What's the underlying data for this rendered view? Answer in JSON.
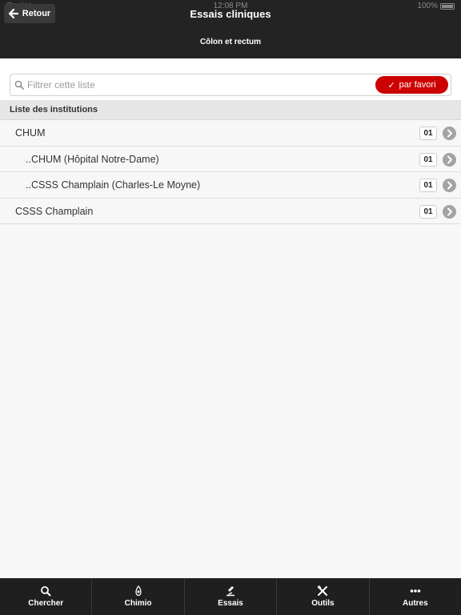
{
  "status_bar": {
    "carrier": "Carrier",
    "time": "12:08 PM",
    "battery": "100%"
  },
  "header": {
    "back_label": "Retour",
    "title": "Essais cliniques",
    "subtitle": "Côlon et rectum"
  },
  "filter": {
    "placeholder": "Filtrer cette liste",
    "value": "",
    "favorite_button": {
      "check": "✓",
      "label": "par favori"
    }
  },
  "section": {
    "title": "Liste des institutions"
  },
  "institutions": [
    {
      "label": "CHUM",
      "count": "01",
      "level": 0
    },
    {
      "label": "..CHUM (Hôpital Notre-Dame)",
      "count": "01",
      "level": 1
    },
    {
      "label": "..CSSS Champlain (Charles-Le Moyne)",
      "count": "01",
      "level": 1
    },
    {
      "label": "CSSS Champlain",
      "count": "01",
      "level": 0
    }
  ],
  "tabs": [
    {
      "label": "Chercher",
      "icon": "search-icon"
    },
    {
      "label": "Chimio",
      "icon": "chemo-icon"
    },
    {
      "label": "Essais",
      "icon": "flask-icon"
    },
    {
      "label": "Outils",
      "icon": "tools-icon"
    },
    {
      "label": "Autres",
      "icon": "more-icon"
    }
  ],
  "colors": {
    "header_bg": "#232323",
    "accent": "#cc0000",
    "tabbar_bg": "#1f1f1f"
  }
}
